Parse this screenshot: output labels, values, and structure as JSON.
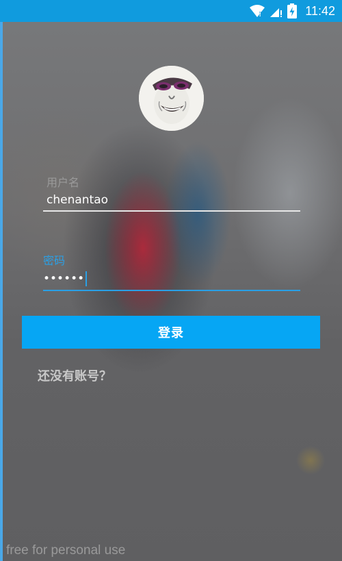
{
  "status_bar": {
    "time": "11:42",
    "icons": [
      "wifi-icon",
      "signal-icon",
      "battery-charging-icon"
    ]
  },
  "avatar": {
    "icon": "avatar-meme-face"
  },
  "form": {
    "username": {
      "label": "用户名",
      "value": "chenantao"
    },
    "password": {
      "label": "密码",
      "value": "••••••"
    },
    "login_label": "登录",
    "register_label": "还没有账号？"
  },
  "watermark": "free for personal use",
  "colors": {
    "status_bar": "#109bde",
    "accent": "#2aa0e6",
    "button": "#06a6f4"
  }
}
